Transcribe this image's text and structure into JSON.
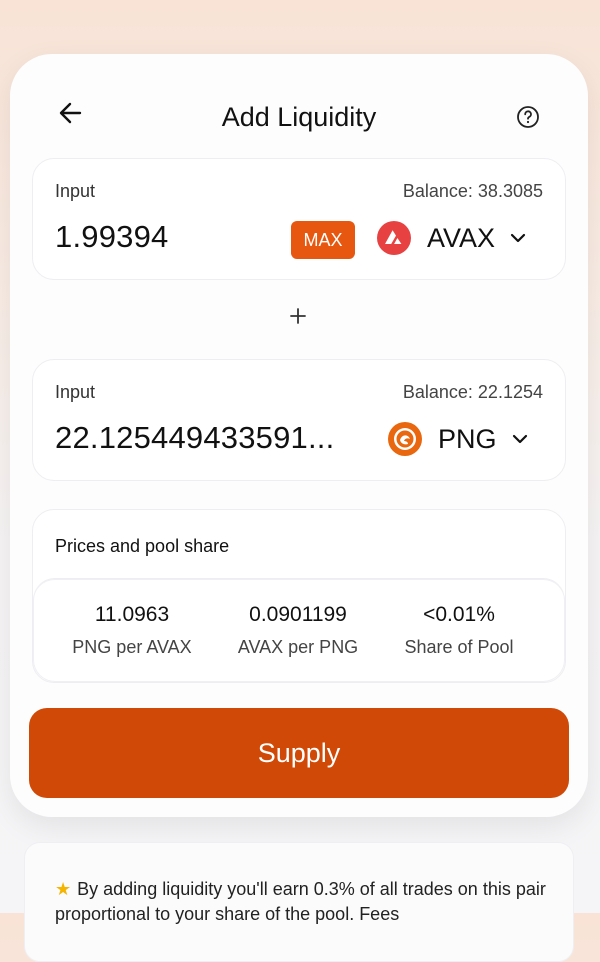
{
  "header": {
    "title": "Add Liquidity"
  },
  "inputs": [
    {
      "label": "Input",
      "balance": "Balance: 38.3085",
      "amount": "1.99394",
      "max_label": "MAX",
      "token": "AVAX"
    },
    {
      "label": "Input",
      "balance": "Balance: 22.1254",
      "amount": "22.125449433591...",
      "token": "PNG"
    }
  ],
  "prices": {
    "title": "Prices and pool share",
    "items": [
      {
        "value": "11.0963",
        "label": "PNG per AVAX"
      },
      {
        "value": "0.0901199",
        "label": "AVAX per PNG"
      },
      {
        "value": "<0.01%",
        "label": "Share of Pool"
      }
    ]
  },
  "supply_label": "Supply",
  "info": {
    "text": "By adding liquidity you'll earn 0.3% of all trades on this pair proportional to your share of the pool. Fees"
  },
  "colors": {
    "accent": "#d14906",
    "max_bg": "#e8570f",
    "avax": "#e84142",
    "png": "#e8670f"
  },
  "icons": {
    "back": "arrow-left-icon",
    "help": "question-circle-icon",
    "plus": "plus-icon",
    "chevron": "chevron-down-icon",
    "star": "star-icon"
  }
}
